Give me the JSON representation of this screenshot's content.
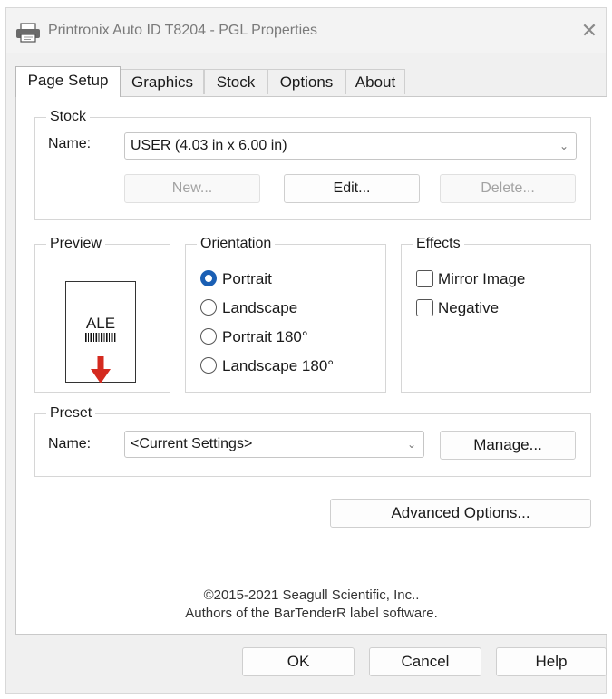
{
  "window": {
    "title": "Printronix Auto ID T8204 - PGL Properties",
    "close_symbol": "✕"
  },
  "tabs": [
    {
      "label": "Page Setup",
      "active": true
    },
    {
      "label": "Graphics",
      "active": false
    },
    {
      "label": "Stock",
      "active": false
    },
    {
      "label": "Options",
      "active": false
    },
    {
      "label": "About",
      "active": false
    }
  ],
  "stock": {
    "legend": "Stock",
    "name_label": "Name:",
    "name_value": "USER (4.03 in x 6.00 in)",
    "new_label": "New...",
    "edit_label": "Edit...",
    "delete_label": "Delete..."
  },
  "preview": {
    "legend": "Preview",
    "sample_text": "ALE",
    "arrow_color": "#d42a1f"
  },
  "orientation": {
    "legend": "Orientation",
    "options": [
      {
        "label": "Portrait",
        "selected": true
      },
      {
        "label": "Landscape",
        "selected": false
      },
      {
        "label": "Portrait 180°",
        "selected": false
      },
      {
        "label": "Landscape 180°",
        "selected": false
      }
    ]
  },
  "effects": {
    "legend": "Effects",
    "options": [
      {
        "label": "Mirror Image",
        "checked": false
      },
      {
        "label": "Negative",
        "checked": false
      }
    ]
  },
  "preset": {
    "legend": "Preset",
    "name_label": "Name:",
    "name_value": "<Current Settings>",
    "manage_label": "Manage..."
  },
  "advanced_label": "Advanced Options...",
  "copyright": {
    "line1": "©2015-2021 Seagull Scientific, Inc..",
    "line2": "Authors of the BarTenderR label software."
  },
  "footer": {
    "ok_label": "OK",
    "cancel_label": "Cancel",
    "help_label": "Help"
  },
  "colors": {
    "accent": "#1a5fb4"
  }
}
